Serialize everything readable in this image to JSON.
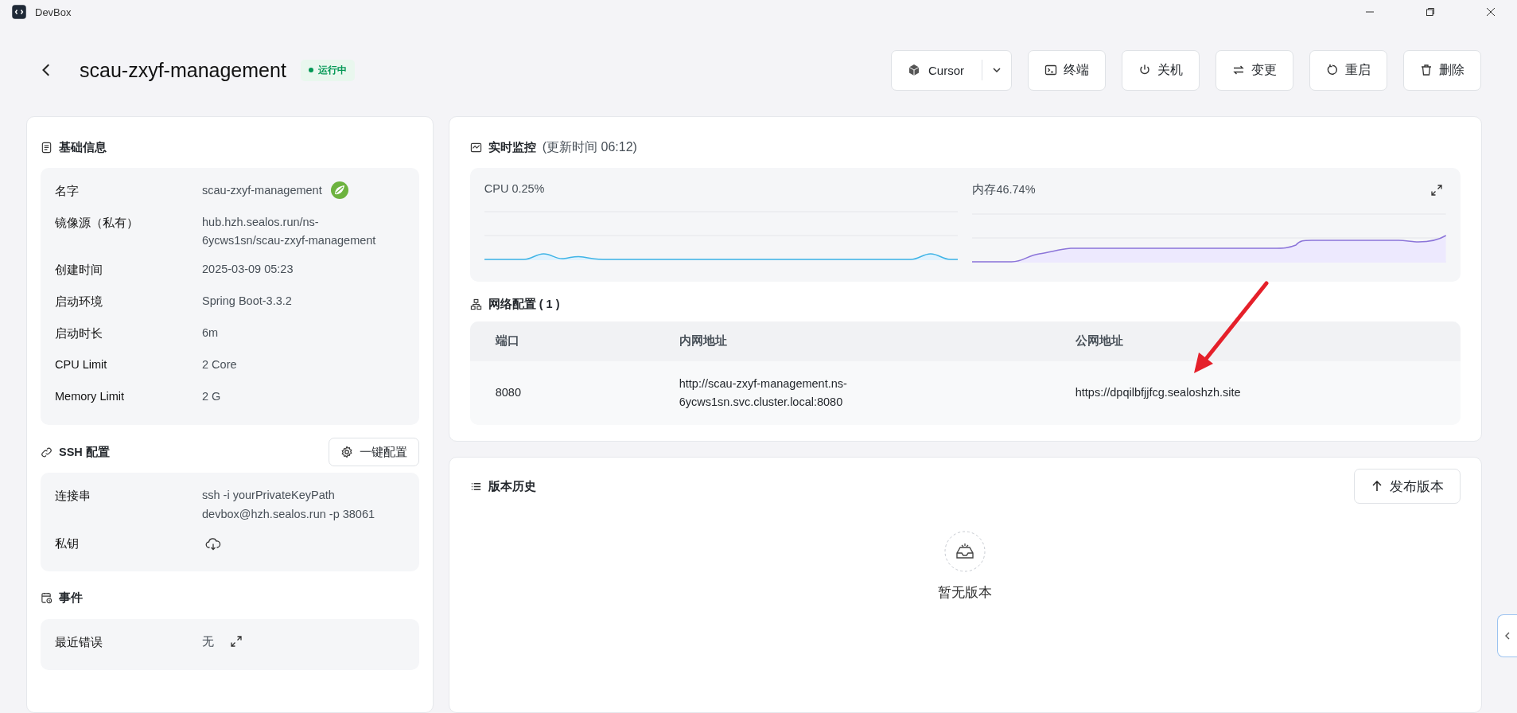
{
  "window": {
    "title": "DevBox"
  },
  "header": {
    "name": "scau-zxyf-management",
    "status": "运行中",
    "ide": "Cursor",
    "actions": [
      {
        "label": "终端",
        "kind": "terminal"
      },
      {
        "label": "关机",
        "kind": "power"
      },
      {
        "label": "变更",
        "kind": "swap"
      },
      {
        "label": "重启",
        "kind": "restart"
      },
      {
        "label": "删除",
        "kind": "trash"
      }
    ]
  },
  "basic_info": {
    "title": "基础信息",
    "rows": [
      {
        "label": "名字",
        "value": "scau-zxyf-management",
        "kind": "runtime"
      },
      {
        "label": "镜像源（私有）",
        "value": "hub.hzh.sealos.run/ns-6ycws1sn/scau-zxyf-management",
        "kind": "text"
      },
      {
        "label": "创建时间",
        "value": "2025-03-09 05:23",
        "kind": "text"
      },
      {
        "label": "启动环境",
        "value": "Spring Boot-3.3.2",
        "kind": "text"
      },
      {
        "label": "启动时长",
        "value": "6m",
        "kind": "text"
      },
      {
        "label": "CPU Limit",
        "value": "2 Core",
        "kind": "text"
      },
      {
        "label": "Memory Limit",
        "value": "2 G",
        "kind": "text"
      }
    ]
  },
  "ssh": {
    "title": "SSH 配置",
    "button": "一键配置",
    "rows": [
      {
        "label": "连接串",
        "value": "ssh -i yourPrivateKeyPath devbox@hzh.sealos.run -p 38061",
        "kind": "text"
      },
      {
        "label": "私钥",
        "kind": "download"
      }
    ]
  },
  "events": {
    "title": "事件",
    "rows": [
      {
        "label": "最近错误",
        "value": "无",
        "kind": "expand"
      }
    ]
  },
  "monitor": {
    "title": "实时监控",
    "updated": "(更新时间  06:12)",
    "cpu": "CPU 0.25%",
    "memory": "内存46.74%"
  },
  "network": {
    "title": "网络配置 ( 1 )",
    "columns": [
      "端口",
      "内网地址",
      "公网地址"
    ],
    "rows": [
      [
        "8080",
        "http://scau-zxyf-management.ns-6ycws1sn.svc.cluster.local:8080",
        "https://dpqilbfjjfcg.sealoshzh.site"
      ]
    ]
  },
  "versions": {
    "title": "版本历史",
    "button": "发布版本",
    "empty": "暂无版本"
  }
}
